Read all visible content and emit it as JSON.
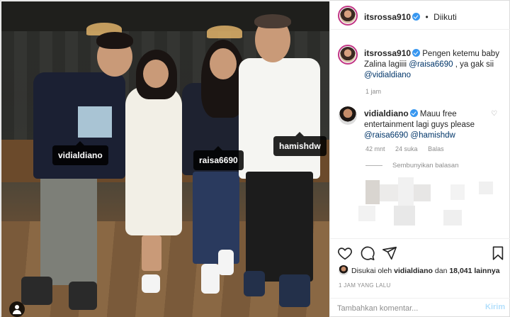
{
  "post": {
    "owner": "itsrossa910",
    "follow_status": "Diikuti",
    "separator": "•",
    "tags": [
      {
        "label": "vidialdiano"
      },
      {
        "label": "raisa6690"
      },
      {
        "label": "hamishdw"
      }
    ]
  },
  "caption": {
    "username": "itsrossa910",
    "text": "Pengen ketemu baby Zalina lagiiii",
    "mention1": "@raisa6690",
    "tail": ", ya gak sii",
    "mention2": "@vidialdiano",
    "time": "1 jam"
  },
  "reply": {
    "username": "vidialdiano",
    "text": "Mauu free entertainment lagi guys please",
    "mention1": "@raisa6690",
    "mention2": "@hamishdw",
    "time": "42 mnt",
    "likes": "24 suka",
    "reply_label": "Balas",
    "hide_replies": "Sembunyikan balasan"
  },
  "actions": {
    "like_icon": "heart-icon",
    "comment_icon": "comment-icon",
    "share_icon": "share-icon",
    "save_icon": "bookmark-icon"
  },
  "likes": {
    "prefix": "Disukai oleh",
    "user": "vidialdiano",
    "middle": "dan",
    "count": "18,041 lainnya"
  },
  "timestamp": "1 JAM YANG LALU",
  "comment_box": {
    "placeholder": "Tambahkan komentar...",
    "post_label": "Kirim"
  },
  "colors": {
    "verified": "#3897f0",
    "mention": "#003569",
    "post_disabled": "#b2dffc"
  }
}
